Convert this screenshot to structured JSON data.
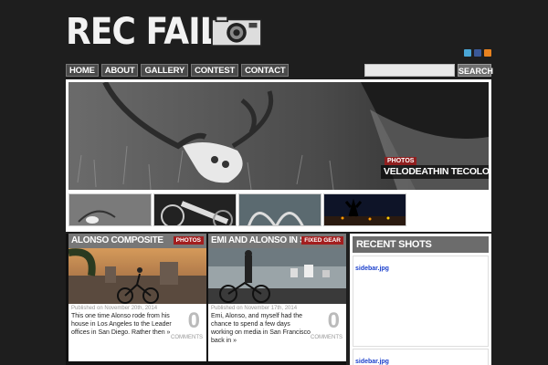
{
  "site": {
    "logo_text": "REC FAIL"
  },
  "nav": {
    "items": [
      "HOME",
      "ABOUT",
      "GALLERY",
      "CONTEST",
      "CONTACT"
    ]
  },
  "search": {
    "button_label": "SEARCH"
  },
  "social": {
    "icons": [
      "twitter-icon",
      "facebook-icon",
      "rss-icon"
    ],
    "colors": [
      "#4aa6d6",
      "#3b5998",
      "#e8821f"
    ]
  },
  "featured": {
    "tag": "PHOTOS",
    "title": "VELODEATHIN TECOLOTE"
  },
  "posts": [
    {
      "title": "ALONSO COMPOSITE",
      "tag": "PHOTOS",
      "date": "Published on November 20th, 2014",
      "excerpt": "This one time Alonso rode from his house in Los Angeles to the Leader offices in San Diego. Rather then »",
      "comments_count": "0",
      "comments_label": "COMMENTS"
    },
    {
      "title": "EMI AND ALONSO IN SF",
      "tag": "FIXED GEAR",
      "date": "Published on November 17th, 2014",
      "excerpt": "Emi, Alonso, and myself had the chance to spend a few days working on media in San Francisco back in »",
      "comments_count": "0",
      "comments_label": "COMMENTS"
    }
  ],
  "sidebar": {
    "heading": "RECENT SHOTS",
    "links": [
      "sidebar.jpg",
      "sidebar.jpg"
    ]
  },
  "colors": {
    "background": "#1e1e1e",
    "accent_red": "#a31e1e",
    "nav_bg": "#4a4a4a",
    "link_blue": "#1a3fcc"
  }
}
